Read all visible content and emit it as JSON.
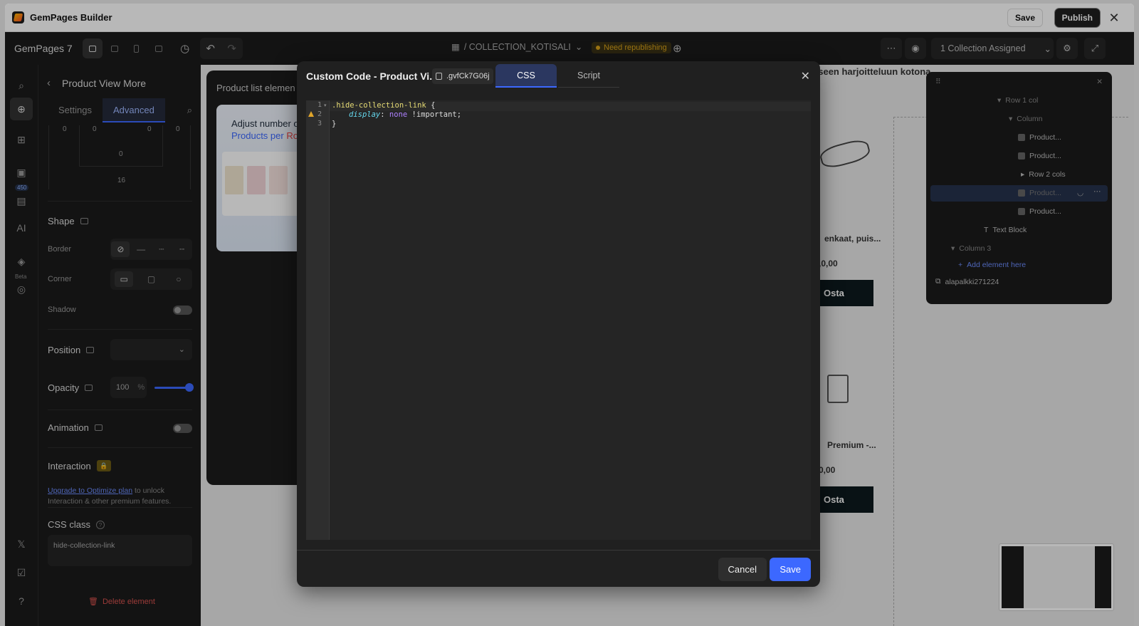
{
  "titlebar": {
    "app_title": "GemPages Builder",
    "save_label": "Save",
    "publish_label": "Publish"
  },
  "topbar": {
    "brand": "GemPages 7",
    "breadcrumb": "/ COLLECTION_KOTISALI",
    "status_badge": "Need republishing",
    "assigned": "1 Collection Assigned"
  },
  "rail": {
    "badge": "450",
    "beta": "Beta",
    "ai": "AI"
  },
  "panel": {
    "title": "Product View More",
    "tabs": [
      "Settings",
      "Advanced"
    ],
    "spacing": {
      "top_left": "0",
      "top_mid_left": "0",
      "top_mid_right": "0",
      "top_right": "0",
      "inner_bottom": "0",
      "bottom": "16"
    },
    "shape_title": "Shape",
    "border_label": "Border",
    "corner_label": "Corner",
    "shadow_label": "Shadow",
    "position_label": "Position",
    "opacity_label": "Opacity",
    "opacity_value": "100",
    "opacity_unit": "%",
    "opacity_level": 1.0,
    "animation_label": "Animation",
    "interaction_label": "Interaction",
    "upgrade_link": "Upgrade to Optimize plan",
    "upgrade_rest": " to unlock Interaction & other premium features.",
    "css_class_label": "CSS class",
    "css_class_value": "hide-collection-link",
    "delete_label": "Delete element"
  },
  "canvas": {
    "heading": "aseen harjoitteluun kotona",
    "item1_title": "enkaat, puis...",
    "item1_price": ",0,00",
    "item2_title": "Premium -...",
    "item2_price": "0,00",
    "buy_label": "Osta",
    "product_list_title": "Product list elemen",
    "promo_line1": "Adjust number o",
    "promo_line2": "Products per Ro",
    "promo_line2_a": "Products per ",
    "promo_line2_b": "Ro"
  },
  "navigator": {
    "items": [
      {
        "label": "Row 1 col"
      },
      {
        "label": "Column"
      },
      {
        "label": "Product..."
      },
      {
        "label": "Product..."
      },
      {
        "label": "Row 2 cols"
      },
      {
        "label": "Product..."
      },
      {
        "label": "Product..."
      },
      {
        "label": "Text Block"
      },
      {
        "label": "Column 3"
      },
      {
        "label": "Add element here"
      },
      {
        "label": "alapalkki271224"
      }
    ]
  },
  "modal": {
    "title": "Custom Code - Product Vi...",
    "element_id": ".gvfCk7G06j",
    "tabs": [
      "CSS",
      "Script"
    ],
    "active_tab": "CSS",
    "code": {
      "line_numbers": [
        "1",
        "2",
        "3"
      ],
      "line1_selector": ".hide-collection-link",
      "line1_brace": " {",
      "line2_prop": "display",
      "line2_colon": ": ",
      "line2_value": "none",
      "line2_rest": " !important;",
      "line3": "}"
    },
    "cancel_label": "Cancel",
    "save_label": "Save"
  }
}
